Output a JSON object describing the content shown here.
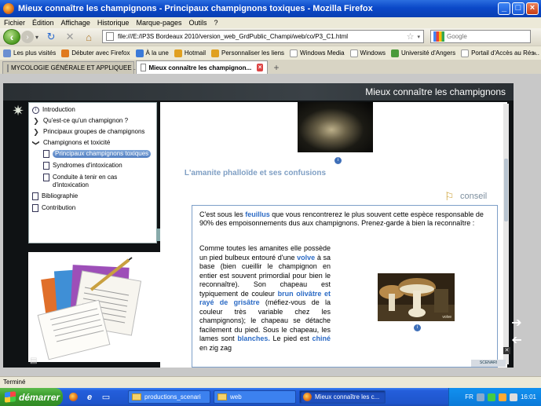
{
  "window": {
    "title": "Mieux connaître les champignons - Principaux champignons toxiques - Mozilla Firefox",
    "controls": {
      "minimize": "_",
      "maximize": "□",
      "close": "×"
    }
  },
  "menu": [
    "Fichier",
    "Édition",
    "Affichage",
    "Historique",
    "Marque-pages",
    "Outils",
    "?"
  ],
  "nav": {
    "back": "‹",
    "forward": "›",
    "history": "▾",
    "reload": "↻",
    "stop": "✕",
    "home": "⌂",
    "url": "file:///E:/IP3S Bordeaux 2010/version_web_GrdPublic_Champi/web/co/P3_C1.html",
    "star": "☆",
    "url_dropdown": "▾",
    "search_placeholder": "Google"
  },
  "bookmarks": [
    {
      "label": "Les plus visités",
      "color": "#6a8fd1"
    },
    {
      "label": "Débuter avec Firefox",
      "color": "#e07a1e"
    },
    {
      "label": "À la une",
      "color": "#3b7ad8"
    },
    {
      "label": "Hotmail",
      "color": "#e0a020"
    },
    {
      "label": "Personnaliser les liens",
      "color": "#e0a020"
    },
    {
      "label": "Windows Media",
      "color": "#ffffff"
    },
    {
      "label": "Windows",
      "color": "#ffffff"
    },
    {
      "label": "Université d'Angers",
      "color": "#4a9a3a"
    },
    {
      "label": "Portail d'Accès au Rés...",
      "color": "#ffffff"
    }
  ],
  "bookmarks_more": "»",
  "tabs": [
    {
      "label": "MYCOLOGIE GÉNÉRALE ET APPLIQUEE ...",
      "active": false
    },
    {
      "label": "Mieux connaître les champignon...",
      "active": true
    }
  ],
  "tab_close": "×",
  "tab_new": "+",
  "module": {
    "title": "Mieux connaître les champignons",
    "sun_icon": "✷",
    "nav_items": [
      {
        "label": "Introduction",
        "icon": "info"
      },
      {
        "label": "Qu'est-ce qu'un champignon ?",
        "icon": "arrow"
      },
      {
        "label": "Principaux groupes de champignons",
        "icon": "arrow"
      },
      {
        "label": "Champignons et toxicité",
        "icon": "arrow-down"
      },
      {
        "label": "Principaux champignons toxiques",
        "icon": "doc",
        "current": true
      },
      {
        "label": "Syndromes d'intoxication",
        "icon": "doc"
      },
      {
        "label": "Conduite à tenir en cas d'intoxication",
        "icon": "doc"
      },
      {
        "label": "Bibliographie",
        "icon": "doc"
      },
      {
        "label": "Contribution",
        "icon": "doc"
      }
    ],
    "nav_bullets": {
      "arrow": "❯",
      "arrow-down": "❯"
    },
    "section_title": "L'amanite phalloïde et ses confusions",
    "conseil_label": "conseil",
    "conseil_icon": "⚐",
    "info": "i",
    "intro": {
      "t1": "C'est sous les ",
      "k1": "feuillus",
      "t2": " que vous rencontrerez le plus souvent cette espèce responsable de 90% des empoisonnements dus aux champignons. Prenez-garde à bien la reconnaître :"
    },
    "body": {
      "t1": "Comme toutes les amanites elle possède un pied bulbeux entouré d'une ",
      "k1": "volve",
      "t2": " à sa base (bien cueillir le champignon en entier est souvent primordial pour bien le reconnaître). Son chapeau est typiquement de couleur ",
      "k2": "brun olivâtre et rayé de grisâtre",
      "t3": " (méfiez-vous de la couleur très variable chez les champignons); le chapeau se détache facilement du pied. Sous le chapeau, les lames sont ",
      "k3": "blanches.",
      "t4": " Le pied est ",
      "k4": "chiné",
      "t5": " en zig zag"
    },
    "photo_caption": "volve",
    "next_arrow": "➔",
    "prev_arrow": "➔",
    "corner_close": "✕",
    "footer_icon": "▤",
    "footer_logo": "SCENARI"
  },
  "status": "Terminé",
  "taskbar": {
    "start": "démarrer",
    "tasks": [
      {
        "label": "productions_scenari",
        "icon": "folder",
        "active": false
      },
      {
        "label": "web",
        "icon": "folder",
        "active": false
      },
      {
        "label": "Mieux connaître les c...",
        "icon": "firefox",
        "active": true
      }
    ],
    "tray_lang": "FR",
    "clock": "16:01"
  },
  "colors": {
    "accent": "#2c6bc5",
    "title_blue": "#0b48c8",
    "taskbar_green": "#3c9e2e"
  }
}
